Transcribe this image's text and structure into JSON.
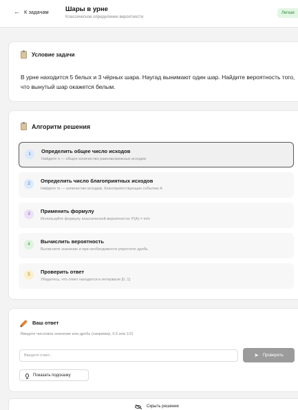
{
  "header": {
    "back_label": "К задачам",
    "title": "Шары в урне",
    "subtitle": "Классическое определение вероятности",
    "badge": "Легкая"
  },
  "condition": {
    "heading": "Условие задачи",
    "text": "В урне находится 5 белых и 3 чёрных шара. Наугад вынимают один шар. Найдите вероятность того, что вынутый шар окажется белым."
  },
  "algorithm": {
    "heading": "Алгоритм решения",
    "steps": [
      {
        "num": "1",
        "title": "Определить общее число исходов",
        "desc": "Найдите n — общее количество равновозможных исходов",
        "color": "#dbe9fb",
        "num_color": "#3d74c4"
      },
      {
        "num": "2",
        "title": "Определить число благоприятных исходов",
        "desc": "Найдите m — количество исходов, благоприятствующих событию A",
        "color": "#dbe9fb",
        "num_color": "#3d74c4"
      },
      {
        "num": "3",
        "title": "Применить формулу",
        "desc": "Используйте формулу классической вероятности: P(A) = m/n",
        "color": "#ece1f7",
        "num_color": "#8a55c2"
      },
      {
        "num": "4",
        "title": "Вычислить вероятность",
        "desc": "Вычислите значение и при необходимости упростите дробь",
        "color": "#dff3df",
        "num_color": "#3b9a45"
      },
      {
        "num": "5",
        "title": "Проверить ответ",
        "desc": "Убедитесь, что ответ находится в интервале [0, 1]",
        "color": "#fbefcd",
        "num_color": "#b08415"
      }
    ]
  },
  "answer": {
    "heading": "Ваш ответ",
    "hint": "Введите числовое значение или дробь (например, 0.5 или 1/2)",
    "placeholder": "Введите ответ...",
    "check_label": "Проверить",
    "hint_button": "Показать подсказку"
  },
  "hide_solution": "Скрыть решение"
}
